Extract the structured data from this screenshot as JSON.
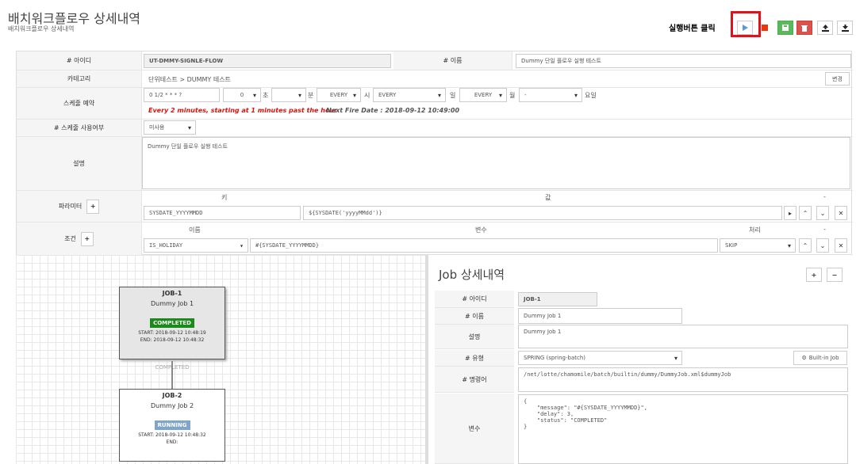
{
  "header": {
    "title": "배치워크플로우 상세내역",
    "subtitle": "배치워크플로우 상세내역",
    "annotation": "실행버튼 클릭"
  },
  "form": {
    "id_label": "# 아이디",
    "id_value": "UT-DMMY-SIGNLE-FLOW",
    "name_label": "# 이름",
    "name_value": "Dummy 단일 플로우 실행 테스트",
    "category_label": "카테고리",
    "category_value": "단위테스트 > DUMMY 테스트",
    "change_btn": "변경",
    "schedule_label": "스케줄 예약",
    "cron": "0 1/2 * * * ?",
    "sec_val": "0",
    "sec": "초",
    "min": "분",
    "every1": "EVERY",
    "hour": "시",
    "every2": "EVERY",
    "day": "일",
    "every3": "EVERY",
    "month": "월",
    "dash": "-",
    "weekday": "요일",
    "schedule_desc": "Every 2 minutes, starting at 1 minutes past the hour",
    "next_fire": "Next Fire Date : 2018-09-12 10:49:00",
    "use_label": "# 스케줄 사용여부",
    "use_value": "미사용",
    "desc_label": "설명",
    "desc_value": "Dummy 단일 플로우 실행 테스트",
    "param_label": "파라미터",
    "param_key_header": "키",
    "param_val_header": "값",
    "param_dash": "-",
    "param_key": "SYSDATE_YYYYMMDD",
    "param_val": "${SYSDATE('yyyyMMdd')}",
    "cond_label": "조건",
    "cond_name_header": "이름",
    "cond_var_header": "변수",
    "cond_proc_header": "처리",
    "cond_dash": "-",
    "cond_name": "IS_HOLIDAY",
    "cond_var": "#{SYSDATE_YYYYMMDD}",
    "cond_proc": "SKIP"
  },
  "canvas": {
    "job1": {
      "id": "JOB-1",
      "name": "Dummy Job 1",
      "status": "COMPLETED",
      "start": "START: 2018-09-12 10:48:19",
      "end": "END: 2018-09-12 10:48:32"
    },
    "link": "COMPLETED",
    "job2": {
      "id": "JOB-2",
      "name": "Dummy Job 2",
      "status": "RUNNING",
      "start": "START: 2018-09-12 10:48:32",
      "end": "END:"
    }
  },
  "detail": {
    "title": "Job 상세내역",
    "plus": "+",
    "minus": "−",
    "id_label": "# 아이디",
    "id_value": "JOB-1",
    "name_label": "# 이름",
    "name_value": "Dummy Job 1",
    "desc_label": "설명",
    "desc_value": "Dummy Job 1",
    "type_label": "# 유형",
    "type_value": "SPRING (spring-batch)",
    "builtin_btn": "Built-in Job",
    "cmd_label": "# 명령어",
    "cmd_value": "/net/lotte/chamomile/batch/builtin/dummy/DummyJob.xml$dummyJob",
    "var_label": "변수",
    "var_lines": [
      "{",
      "    \"message\": \"#{SYSDATE_YYYYMMDD}\",",
      "    \"delay\": 3,",
      "    \"status\": \"COMPLETED\"",
      "}"
    ]
  },
  "colors": {
    "completed": "#1a8a1a",
    "running": "#7ea6cc",
    "highlight": "#e0121a"
  }
}
